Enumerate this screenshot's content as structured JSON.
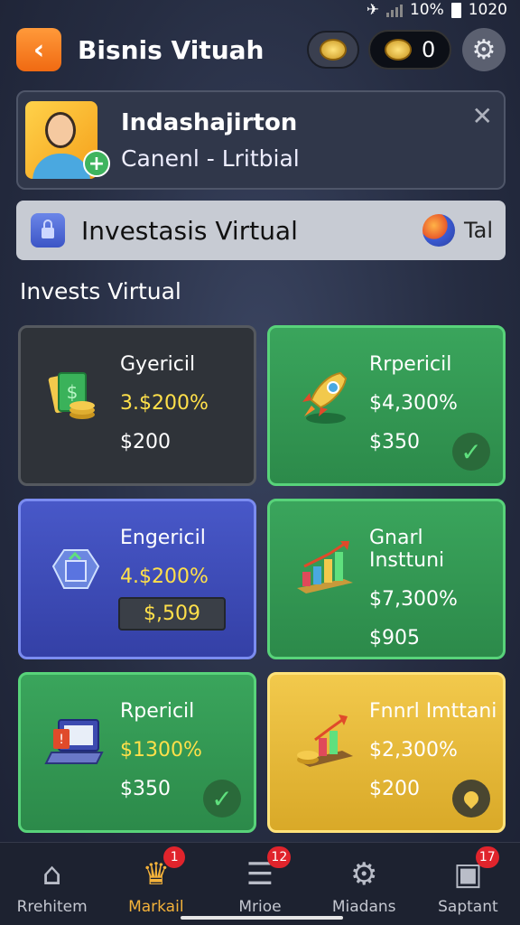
{
  "status": {
    "battery": "10%",
    "time": "1020"
  },
  "header": {
    "title": "Bisnis Vituah",
    "coins": "0"
  },
  "profile": {
    "name": "Indashajirton",
    "subtitle": "Canenl - Lritbial"
  },
  "banner": {
    "title": "Investasis Virtual",
    "link": "Tal"
  },
  "section_title": "Invests Virtual",
  "cards": [
    {
      "label": "Gyericil",
      "rate": "3.$200%",
      "amount": "$200",
      "style": "dark",
      "icon": "money-stack-icon"
    },
    {
      "label": "Rrpericil",
      "rate": "$4,300%",
      "amount": "$350",
      "style": "green",
      "icon": "rocket-icon",
      "badge": "check"
    },
    {
      "label": "Engericil",
      "rate": "4.$200%",
      "amount": "$,509",
      "style": "blue",
      "icon": "crystal-box-icon"
    },
    {
      "label": "Gnarl Insttuni",
      "rate": "$7,300%",
      "amount": "$905",
      "style": "green",
      "icon": "bar-chart-icon"
    },
    {
      "label": "Rpericil",
      "rate": "$1300%",
      "amount": "$350",
      "style": "green",
      "icon": "laptop-icon",
      "badge": "check"
    },
    {
      "label": "Fnnrl Imttani",
      "rate": "$2,300%",
      "amount": "$200",
      "style": "gold",
      "icon": "growth-chart-icon",
      "badge": "pin"
    }
  ],
  "nav": [
    {
      "label": "Rrehitem",
      "icon": "home-icon"
    },
    {
      "label": "Markail",
      "icon": "crown-icon",
      "badge": "1",
      "active": true
    },
    {
      "label": "Mrioe",
      "icon": "list-icon",
      "badge": "12"
    },
    {
      "label": "Miadans",
      "icon": "gear-icon"
    },
    {
      "label": "Saptant",
      "icon": "wallet-icon",
      "badge": "17"
    }
  ]
}
